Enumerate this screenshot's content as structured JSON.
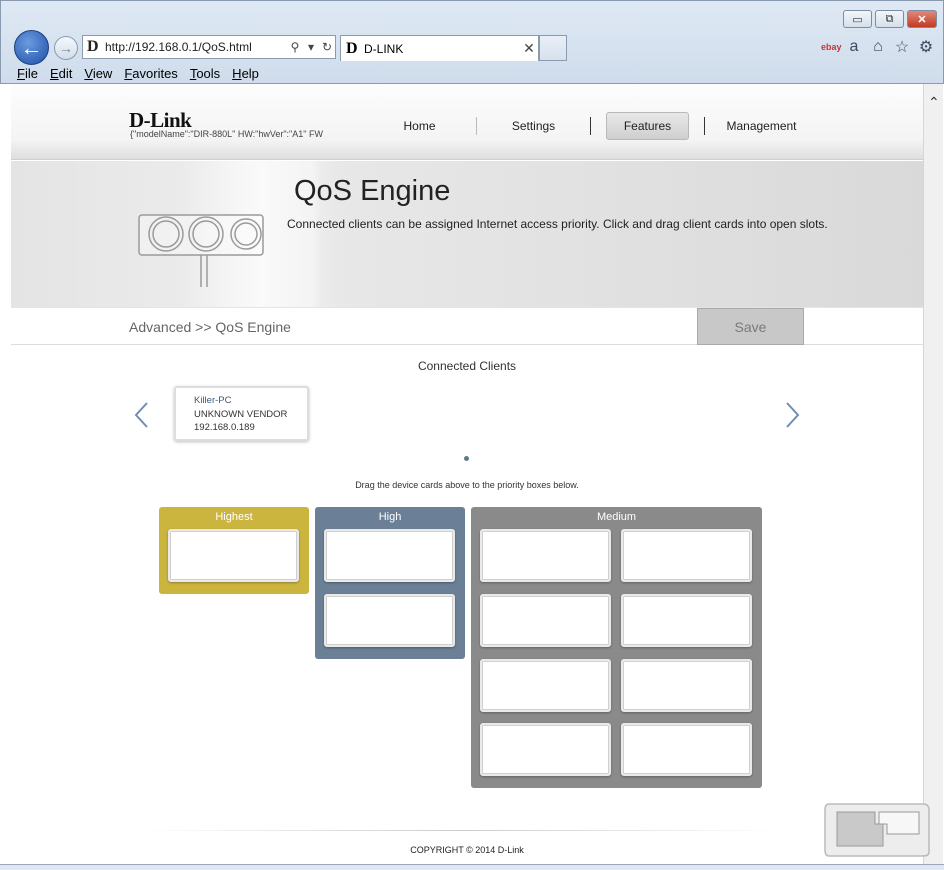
{
  "browser": {
    "url": "http://192.168.0.1/QoS.html",
    "favicon_letter": "D",
    "tab_title": "D-LINK",
    "ebay": "ebay",
    "window_controls": [
      "▭",
      "⧉",
      "✕"
    ],
    "menu": [
      "File",
      "Edit",
      "View",
      "Favorites",
      "Tools",
      "Help"
    ],
    "icons": [
      "back-icon",
      "forward-icon",
      "search-icon",
      "refresh-icon",
      "home-icon",
      "favorites-star-icon",
      "gear-icon"
    ]
  },
  "header": {
    "logo": "D-Link",
    "model_info": "{\"modelName\":\"DIR-880L\"   HW:\"hwVer\":\"A1\"   FW",
    "nav": [
      "Home",
      "Settings",
      "Features",
      "Management"
    ],
    "active_nav": "Features"
  },
  "banner": {
    "title": "QoS Engine",
    "description": "Connected clients can be assigned Internet access priority. Click and drag client cards into open slots."
  },
  "breadcrumb": "Advanced >> QoS Engine",
  "save_label": "Save",
  "clients": {
    "title": "Connected Clients",
    "items": [
      {
        "name": "Killer-PC",
        "vendor": "UNKNOWN VENDOR",
        "ip": "192.168.0.189"
      }
    ],
    "hint": "Drag the device cards above to the priority boxes below."
  },
  "priority": {
    "highest": {
      "label": "Highest",
      "slots": 1
    },
    "high": {
      "label": "High",
      "slots": 2
    },
    "medium": {
      "label": "Medium",
      "slots": 8
    }
  },
  "footer": "COPYRIGHT © 2014 D-Link",
  "colors": {
    "highest": "#cbb53f",
    "high": "#6b8096",
    "medium": "#8a8a8a"
  }
}
